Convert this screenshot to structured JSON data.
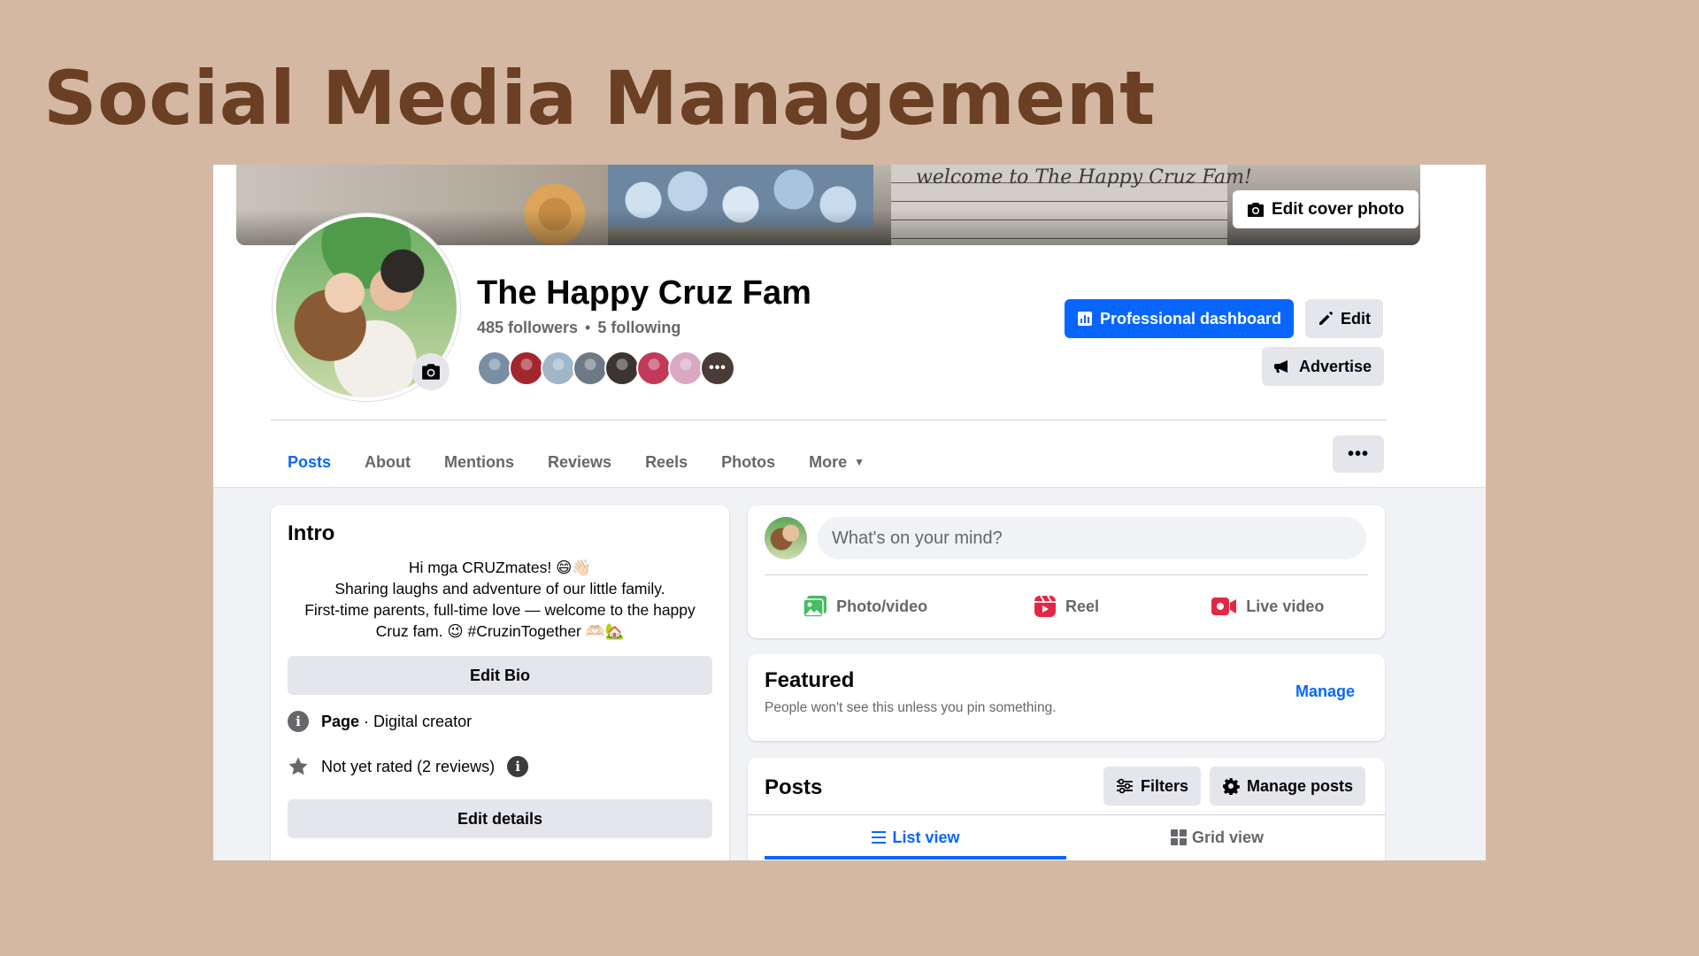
{
  "slide_title": "Social Media Management",
  "cover": {
    "note_text": "welcome to The Happy Cruz Fam!",
    "edit_cover_label": "Edit cover photo"
  },
  "profile": {
    "name": "The Happy Cruz Fam",
    "followers": "485 followers",
    "separator": "•",
    "following": "5 following",
    "friend_avatar_colors": [
      "#7a8ea3",
      "#a3262e",
      "#9fb6c9",
      "#6d7a86",
      "#3b3432",
      "#c2395a",
      "#d9a9c4"
    ],
    "friend_more_label": "•••"
  },
  "actions": {
    "professional_dashboard": "Professional dashboard",
    "edit": "Edit",
    "advertise": "Advertise"
  },
  "tabs": [
    {
      "label": "Posts",
      "active": true
    },
    {
      "label": "About"
    },
    {
      "label": "Mentions"
    },
    {
      "label": "Reviews"
    },
    {
      "label": "Reels"
    },
    {
      "label": "Photos"
    },
    {
      "label": "More"
    }
  ],
  "more_menu_label": "•••",
  "intro": {
    "title": "Intro",
    "bio_lines": [
      "Hi mga CRUZmates! 😄👋🏻",
      "Sharing laughs and adventure of our little family.",
      "First-time parents, full-time love — welcome to the happy",
      "Cruz fam. 😉 #CruzinTogether 🫶🏻🏡"
    ],
    "edit_bio": "Edit Bio",
    "page_label": "Page",
    "page_category": " · Digital creator",
    "rating": "Not yet rated (2 reviews)",
    "edit_details": "Edit details"
  },
  "composer": {
    "placeholder": "What's on your mind?",
    "photo_video": "Photo/video",
    "reel": "Reel",
    "live_video": "Live video"
  },
  "featured": {
    "title": "Featured",
    "subtitle": "People won't see this unless you pin something.",
    "manage": "Manage"
  },
  "posts": {
    "title": "Posts",
    "filters": "Filters",
    "manage_posts": "Manage posts",
    "list_view": "List view",
    "grid_view": "Grid view"
  },
  "colors": {
    "accent": "#0866ff",
    "slide_bg": "#d4b8a4",
    "title": "#6b3f24"
  }
}
